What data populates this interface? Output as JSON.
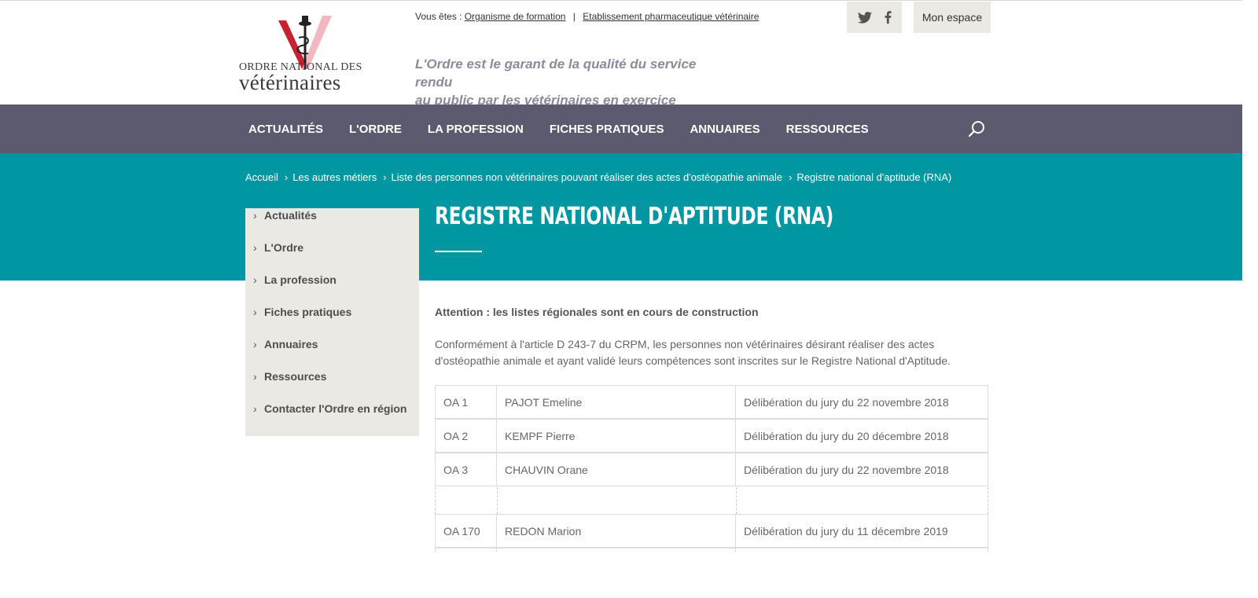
{
  "header": {
    "logo_line1": "ORDRE NATIONAL DES",
    "logo_line2": "vétérinaires",
    "you_are_label": "Vous êtes :",
    "you_are_links": [
      "Organisme de formation",
      "Etablissement pharmaceutique vétérinaire"
    ],
    "tagline_line1": "L'Ordre est le garant de la qualité du service rendu",
    "tagline_line2": "au public par les vétérinaires en exercice",
    "mon_espace": "Mon espace"
  },
  "nav": {
    "items": [
      "ACTUALITÉS",
      "L'ORDRE",
      "LA PROFESSION",
      "FICHES PRATIQUES",
      "ANNUAIRES",
      "RESSOURCES"
    ]
  },
  "breadcrumb": [
    "Accueil",
    "Les autres métiers",
    "Liste des personnes non vétérinaires pouvant réaliser des actes d'ostéopathie animale",
    "Registre national d'aptitude (RNA)"
  ],
  "page": {
    "title": "REGISTRE NATIONAL D'APTITUDE (RNA)",
    "attention": "Attention : les listes régionales sont en cours de construction",
    "intro": "Conformément à l'article D 243-7 du CRPM, les personnes non vétérinaires désirant réaliser des actes d'ostéopathie animale et ayant validé leurs compétences sont inscrites sur le Registre National d'Aptitude."
  },
  "sidebar": {
    "items": [
      "Actualités",
      "L'Ordre",
      "La profession",
      "Fiches pratiques",
      "Annuaires",
      "Ressources",
      "Contacter l'Ordre en région"
    ]
  },
  "table": {
    "rows": [
      [
        "OA 1",
        "PAJOT Emeline",
        "Délibération du jury du 22 novembre 2018"
      ],
      [
        "OA 2",
        "KEMPF Pierre",
        "Délibération du jury du 20 décembre 2018"
      ],
      [
        "OA 3",
        "CHAUVIN Orane",
        "Délibération du jury du 22 novembre 2018"
      ],
      [
        "OA 170",
        "REDON Marion",
        "Délibération du jury du 11 décembre 2019"
      ]
    ]
  },
  "colors": {
    "nav_bg": "#5b5a6e",
    "teal": "#0097a3",
    "sidebar_bg": "#ebe9e4",
    "tagline": "#8d8a9e"
  }
}
